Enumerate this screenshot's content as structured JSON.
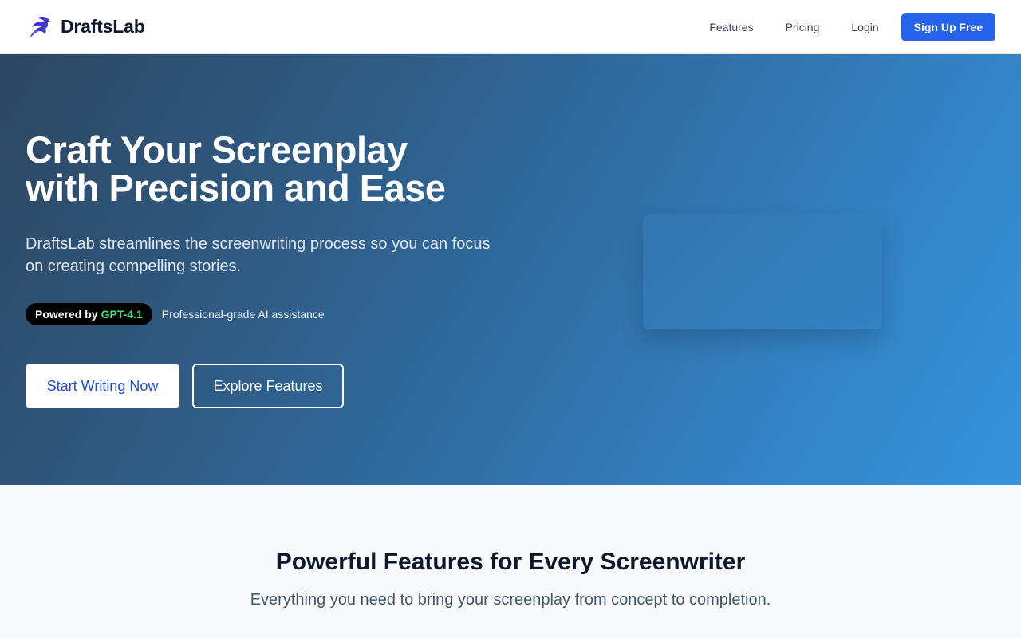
{
  "nav": {
    "brand": "DraftsLab",
    "logo_icon": "dragon-logo-icon",
    "links": [
      "Features",
      "Pricing",
      "Login"
    ],
    "cta": "Sign Up Free"
  },
  "hero": {
    "title_lines": [
      "Craft Your Screenplay",
      "with Precision and Ease"
    ],
    "subtitle_lines": [
      "DraftsLab streamlines the screenwriting process so you can focus",
      "on creating compelling stories."
    ],
    "badge_prefix": "Powered by",
    "badge_model": "GPT-4.1",
    "badge_caption": "Professional-grade AI assistance",
    "primary_button": "Start Writing Now",
    "secondary_button": "Explore Features"
  },
  "features": {
    "title": "Powerful Features for Every Screenwriter",
    "subtitle": "Everything you need to bring your screenplay from concept to completion."
  },
  "colors": {
    "accent": "#2563eb",
    "hero_gradient_start": "#2e4660",
    "hero_gradient_end": "#3595d9",
    "model_highlight": "#4ade80",
    "logo": "#4338ca"
  }
}
